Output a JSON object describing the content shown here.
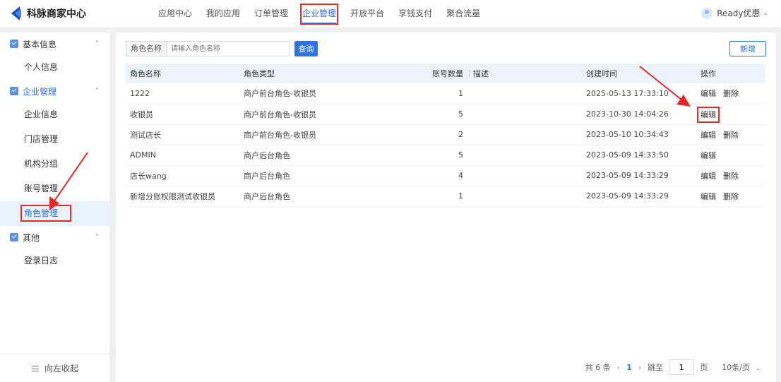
{
  "header": {
    "brand": "科脉商家中心",
    "nav": [
      {
        "label": "应用中心"
      },
      {
        "label": "我的应用"
      },
      {
        "label": "订单管理"
      },
      {
        "label": "企业管理"
      },
      {
        "label": "开放平台"
      },
      {
        "label": "享钱支付"
      },
      {
        "label": "聚合流量"
      }
    ],
    "active_nav": "企业管理",
    "user": "Ready优惠"
  },
  "sidebar": {
    "groups": [
      {
        "label": "基本信息",
        "items": [
          "个人信息"
        ]
      },
      {
        "label": "企业管理",
        "items": [
          "企业信息",
          "门店管理",
          "机构分组",
          "账号管理",
          "角色管理"
        ]
      },
      {
        "label": "其他",
        "items": [
          "登录日志"
        ]
      }
    ],
    "active_item": "角色管理",
    "collapse_label": "向左收起"
  },
  "search": {
    "label": "角色名称",
    "placeholder": "请输入角色名称",
    "button": "查询"
  },
  "add_button": "新增",
  "table": {
    "columns": [
      "角色名称",
      "角色类型",
      "账号数量",
      "描述",
      "创建时间",
      "操作"
    ],
    "rows": [
      {
        "name": "1222",
        "type": "商户前台角色-收银员",
        "count": "1",
        "desc": "",
        "created": "2025-05-13 17:33:10",
        "ops": [
          "编辑",
          "删除"
        ]
      },
      {
        "name": "收银员",
        "type": "商户前台角色-收银员",
        "count": "5",
        "desc": "",
        "created": "2023-10-30 14:04:26",
        "ops": [
          "编辑"
        ]
      },
      {
        "name": "测试店长",
        "type": "商户前台角色-收银员",
        "count": "2",
        "desc": "",
        "created": "2023-05-10 10:34:43",
        "ops": [
          "编辑",
          "删除"
        ]
      },
      {
        "name": "ADMIN",
        "type": "商户后台角色",
        "count": "5",
        "desc": "",
        "created": "2023-05-09 14:33:50",
        "ops": [
          "编辑"
        ]
      },
      {
        "name": "店长wang",
        "type": "商户后台角色",
        "count": "4",
        "desc": "",
        "created": "2023-05-09 14:33:29",
        "ops": [
          "编辑",
          "删除"
        ]
      },
      {
        "name": "新增分账权限测试收银员",
        "type": "商户后台角色",
        "count": "1",
        "desc": "",
        "created": "2023-05-09 14:33:29",
        "ops": [
          "编辑",
          "删除"
        ]
      }
    ]
  },
  "pagination": {
    "total": "共 6 条",
    "current": "1",
    "goto_label": "跳至",
    "goto_value": "1",
    "page_unit": "页",
    "page_size": "10条/页"
  },
  "colors": {
    "accent": "#2f6fe0",
    "annotation": "#e02b2b"
  }
}
